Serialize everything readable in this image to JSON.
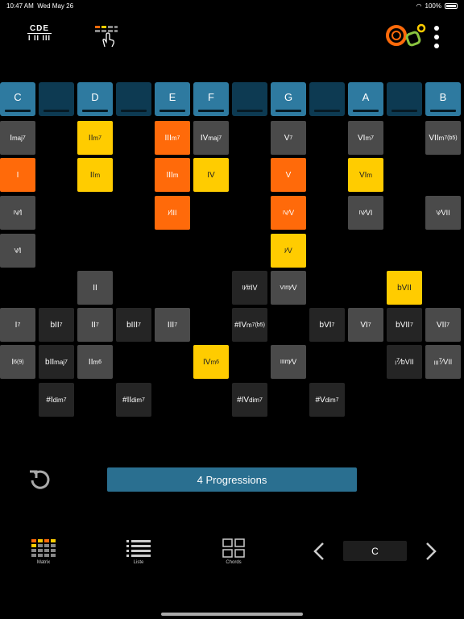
{
  "status": {
    "time": "10:47 AM",
    "date": "Wed May 26",
    "battery": "100%"
  },
  "header": {
    "notes_top": "CDE",
    "notes_bottom": "I II III"
  },
  "keys": [
    {
      "label": "C",
      "white": true
    },
    {
      "label": "",
      "white": false
    },
    {
      "label": "D",
      "white": true
    },
    {
      "label": "",
      "white": false
    },
    {
      "label": "E",
      "white": true
    },
    {
      "label": "F",
      "white": true
    },
    {
      "label": "",
      "white": false
    },
    {
      "label": "G",
      "white": true
    },
    {
      "label": "",
      "white": false
    },
    {
      "label": "A",
      "white": true
    },
    {
      "label": "",
      "white": false
    },
    {
      "label": "B",
      "white": true
    }
  ],
  "grid": [
    {
      "col": 0,
      "row": 0,
      "html": "I<small>maj</small><sup>7</sup>",
      "color": "gray"
    },
    {
      "col": 2,
      "row": 0,
      "html": "II<small>m</small><sup>7</sup>",
      "color": "yellow"
    },
    {
      "col": 4,
      "row": 0,
      "html": "III<small>m</small><sup>7</sup>",
      "color": "orange"
    },
    {
      "col": 5,
      "row": 0,
      "html": "IV<small>maj</small><sup>7</sup>",
      "color": "gray"
    },
    {
      "col": 7,
      "row": 0,
      "html": "V<sup>7</sup>",
      "color": "gray"
    },
    {
      "col": 9,
      "row": 0,
      "html": "VI<small>m</small><sup>7</sup>",
      "color": "gray"
    },
    {
      "col": 11,
      "row": 0,
      "html": "VII<small>m</small><sup>7(b5)</sup>",
      "color": "gray"
    },
    {
      "col": 0,
      "row": 1,
      "html": "I",
      "color": "orange"
    },
    {
      "col": 2,
      "row": 1,
      "html": "II<small>m</small>",
      "color": "yellow"
    },
    {
      "col": 4,
      "row": 1,
      "html": "III<small>m</small>",
      "color": "orange"
    },
    {
      "col": 5,
      "row": 1,
      "html": "IV",
      "color": "yellow"
    },
    {
      "col": 7,
      "row": 1,
      "html": "V",
      "color": "orange"
    },
    {
      "col": 9,
      "row": 1,
      "html": "VI<small>m</small>",
      "color": "yellow"
    },
    {
      "col": 0,
      "row": 2,
      "html": "<sup>IV</sup>⁄<sub>I</sub>",
      "color": "gray"
    },
    {
      "col": 4,
      "row": 2,
      "html": "<sup>I</sup>⁄<sub>III</sub>",
      "color": "orange"
    },
    {
      "col": 7,
      "row": 2,
      "html": "<sup>IV</sup>⁄<sub>V</sub>",
      "color": "orange"
    },
    {
      "col": 9,
      "row": 2,
      "html": "<sup>IV</sup>⁄<sub>VI</sub>",
      "color": "gray"
    },
    {
      "col": 11,
      "row": 2,
      "html": "<sup>V</sup>⁄<sub>VII</sub>",
      "color": "gray"
    },
    {
      "col": 0,
      "row": 3,
      "html": "<sup>V</sup>⁄<sub>I</sub>",
      "color": "gray"
    },
    {
      "col": 7,
      "row": 3,
      "html": "<sup>I</sup>⁄<sub>V</sub>",
      "color": "yellow"
    },
    {
      "col": 2,
      "row": 4,
      "html": "II",
      "color": "gray"
    },
    {
      "col": 6,
      "row": 4,
      "html": "<sup>II</sup>⁄<sub>#IV</sub>",
      "color": "dark"
    },
    {
      "col": 7,
      "row": 4,
      "html": "<sup>VI<small>m</small></sup>⁄<sub>V</sub>",
      "color": "gray"
    },
    {
      "col": 10,
      "row": 4,
      "html": "bVII",
      "color": "yellow"
    },
    {
      "col": 0,
      "row": 5,
      "html": "I<sup>7</sup>",
      "color": "gray"
    },
    {
      "col": 1,
      "row": 5,
      "html": "bII<sup>7</sup>",
      "color": "dark"
    },
    {
      "col": 2,
      "row": 5,
      "html": "II<sup>7</sup>",
      "color": "gray"
    },
    {
      "col": 3,
      "row": 5,
      "html": "bIII<sup>7</sup>",
      "color": "dark"
    },
    {
      "col": 4,
      "row": 5,
      "html": "III<sup>7</sup>",
      "color": "gray"
    },
    {
      "col": 6,
      "row": 5,
      "html": "#IV<small>m</small><sup>7(b5)</sup>",
      "color": "dark"
    },
    {
      "col": 8,
      "row": 5,
      "html": "bVI<sup>7</sup>",
      "color": "dark"
    },
    {
      "col": 9,
      "row": 5,
      "html": "VI<sup>7</sup>",
      "color": "gray"
    },
    {
      "col": 10,
      "row": 5,
      "html": "bVII<sup>7</sup>",
      "color": "dark"
    },
    {
      "col": 11,
      "row": 5,
      "html": "VII<sup>7</sup>",
      "color": "gray"
    },
    {
      "col": 0,
      "row": 6,
      "html": "I<sup>6(9)</sup>",
      "color": "gray"
    },
    {
      "col": 1,
      "row": 6,
      "html": "bII<small>maj</small><sup>7</sup>",
      "color": "dark"
    },
    {
      "col": 2,
      "row": 6,
      "html": "II<small>m</small><sup>6</sup>",
      "color": "gray"
    },
    {
      "col": 5,
      "row": 6,
      "html": "IV<small>m</small><sup>6</sup>",
      "color": "yellow"
    },
    {
      "col": 7,
      "row": 6,
      "html": "<sup>III<small>m</small></sup>⁄<sub>V</sub>",
      "color": "gray"
    },
    {
      "col": 10,
      "row": 6,
      "html": "<sup>I<sup>7</sup></sup>⁄<sub>bVII</sub>",
      "color": "dark"
    },
    {
      "col": 11,
      "row": 6,
      "html": "<sup>III<sup>7</sup></sup>⁄<sub>VII</sub>",
      "color": "gray"
    },
    {
      "col": 1,
      "row": 7,
      "html": "#I<small>dim</small><sup>7</sup>",
      "color": "dark"
    },
    {
      "col": 3,
      "row": 7,
      "html": "#II<small>dim</small><sup>7</sup>",
      "color": "dark"
    },
    {
      "col": 6,
      "row": 7,
      "html": "#IV<small>dim</small><sup>7</sup>",
      "color": "dark"
    },
    {
      "col": 8,
      "row": 7,
      "html": "#V<small>dim</small><sup>7</sup>",
      "color": "dark"
    }
  ],
  "progressions_label": "4 Progressions",
  "tabs": [
    {
      "label": "Matrix"
    },
    {
      "label": "Liste"
    },
    {
      "label": "Chords"
    }
  ],
  "current_key": "C",
  "colors": {
    "orange": "#ff6a0a",
    "yellow": "#ffcc00",
    "blue": "#2a6f90",
    "gray": "#4a4a4a"
  }
}
